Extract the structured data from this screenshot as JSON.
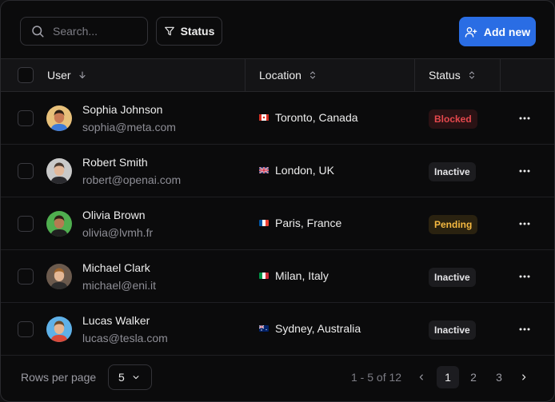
{
  "toolbar": {
    "search_placeholder": "Search...",
    "status_filter_label": "Status",
    "add_button_label": "Add new"
  },
  "table": {
    "columns": [
      {
        "label": "User",
        "sort": "desc"
      },
      {
        "label": "Location",
        "sort": "both"
      },
      {
        "label": "Status",
        "sort": "both"
      }
    ],
    "rows": [
      {
        "name": "Sophia Johnson",
        "email": "sophia@meta.com",
        "flag": "canada-flag",
        "location": "Toronto, Canada",
        "status": "Blocked",
        "status_color": "#e5484d",
        "status_bg": "#2a1214",
        "avatar_bg": "#e8c07a",
        "avatar_skin": "#c97a55",
        "avatar_hair": "#2b1d14",
        "avatar_shirt": "#3d7bd9"
      },
      {
        "name": "Robert Smith",
        "email": "robert@openai.com",
        "flag": "uk-flag",
        "location": "London, UK",
        "status": "Inactive",
        "status_color": "#e4e4e7",
        "status_bg": "#1c1c1f",
        "avatar_bg": "#c9c9c9",
        "avatar_skin": "#e2b89a",
        "avatar_hair": "#4a3a30",
        "avatar_shirt": "#2a2a2e"
      },
      {
        "name": "Olivia Brown",
        "email": "olivia@lvmh.fr",
        "flag": "france-flag",
        "location": "Paris, France",
        "status": "Pending",
        "status_color": "#f5b941",
        "status_bg": "#2a2210",
        "avatar_bg": "#4fae4f",
        "avatar_skin": "#b57a52",
        "avatar_hair": "#2b1d14",
        "avatar_shirt": "#1f1f1f"
      },
      {
        "name": "Michael Clark",
        "email": "michael@eni.it",
        "flag": "italy-flag",
        "location": "Milan, Italy",
        "status": "Inactive",
        "status_color": "#e4e4e7",
        "status_bg": "#1c1c1f",
        "avatar_bg": "#6b5a4d",
        "avatar_skin": "#e5b896",
        "avatar_hair": "#a0662e",
        "avatar_shirt": "#2d2d2d"
      },
      {
        "name": "Lucas Walker",
        "email": "lucas@tesla.com",
        "flag": "australia-flag",
        "location": "Sydney, Australia",
        "status": "Inactive",
        "status_color": "#e4e4e7",
        "status_bg": "#1c1c1f",
        "avatar_bg": "#5fb1e8",
        "avatar_skin": "#e7b590",
        "avatar_hair": "#6b4a2a",
        "avatar_shirt": "#d94a3a"
      }
    ]
  },
  "footer": {
    "rows_per_page_label": "Rows per page",
    "rows_per_page_value": "5",
    "range_text": "1 - 5 of 12",
    "pages": [
      "1",
      "2",
      "3"
    ],
    "current_page": "1"
  },
  "colors": {
    "accent": "#2a6de4",
    "background": "#0b0b0c",
    "blocked": "#e5484d",
    "pending": "#f5b941"
  }
}
